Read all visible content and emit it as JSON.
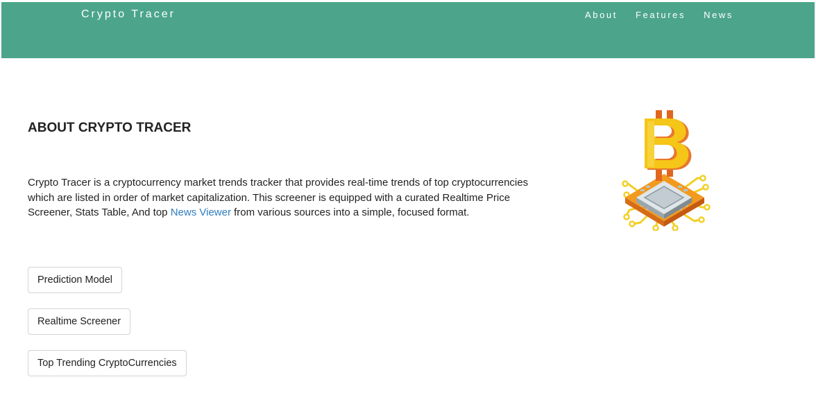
{
  "header": {
    "brand": "Crypto Tracer",
    "nav": [
      "About",
      "Features",
      "News"
    ]
  },
  "about": {
    "title": "ABOUT CRYPTO TRACER",
    "description_before_link": "Crypto Tracer is a cryptocurrency market trends tracker that provides real-time trends of top cryptocurrencies which are listed in order of market capitalization. This screener is equipped with a curated Realtime Price Screener, Stats Table, And top ",
    "link_text": "News Viewer",
    "description_after_link": " from various sources into a simple, focused format."
  },
  "buttons": [
    "Prediction Model",
    "Realtime Screener",
    "Top Trending CryptoCurrencies"
  ],
  "illustration": {
    "icon": "bitcoin-chip-icon"
  },
  "colors": {
    "navbar": "#4ca58a",
    "link": "#2f7dc0",
    "bitcoin_gold": "#f5c518",
    "bitcoin_orange": "#e8772e"
  }
}
